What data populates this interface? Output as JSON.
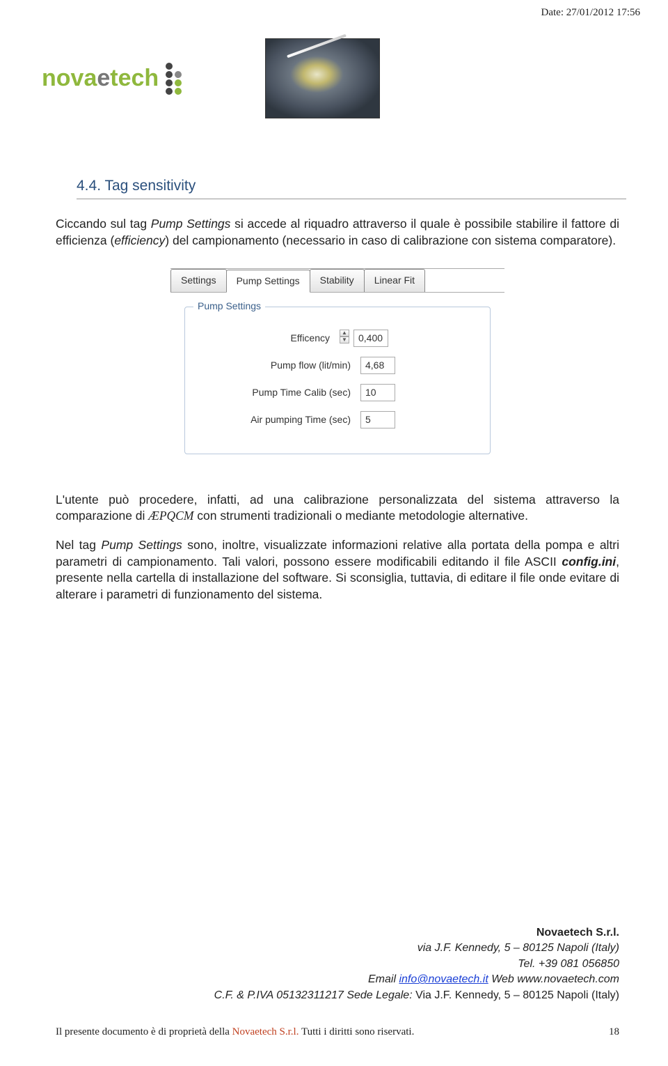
{
  "meta": {
    "date": "Date: 27/01/2012 17:56"
  },
  "logo": {
    "nova": "nova",
    "e": "e",
    "tech": "tech"
  },
  "heading": "4.4.   Tag sensitivity",
  "para1_pre": "Ciccando sul tag ",
  "para1_em": "Pump Settings",
  "para1_mid": " si accede al riquadro attraverso il quale è possibile stabilire il fattore di efficienza (",
  "para1_em2": "efficiency",
  "para1_post": ") del campionamento (necessario in caso di calibrazione con sistema comparatore).",
  "ui": {
    "tabs": [
      "Settings",
      "Pump Settings",
      "Stability",
      "Linear Fit"
    ],
    "legend": "Pump Settings",
    "rows": [
      {
        "label": "Efficency",
        "value": "0,400"
      },
      {
        "label": "Pump flow (lit/min)",
        "value": "4,68"
      },
      {
        "label": "Pump Time Calib (sec)",
        "value": "10"
      },
      {
        "label": "Air pumping Time (sec)",
        "value": "5"
      }
    ]
  },
  "para2_pre": "L'utente può procedere, infatti,  ad una calibrazione personalizzata del sistema attraverso la comparazione di ",
  "para2_app": "ÆPQCM",
  "para2_post": " con strumenti tradizionali o mediante metodologie alternative.",
  "para3_pre": "Nel tag ",
  "para3_em": "Pump Settings",
  "para3_mid": " sono, inoltre, visualizzate informazioni relative  alla portata della pompa e altri parametri di  campionamento. Tali valori,   possono essere modificabili editando il file ASCII ",
  "para3_b": "config.ini",
  "para3_post": ", presente nella cartella di installazione del software. Si sconsiglia, tuttavia, di editare il file onde evitare di alterare i parametri di funzionamento del sistema.",
  "footer": {
    "company": "Novaetech S.r.l.",
    "addr": "via J.F. Kennedy, 5 – 80125 Napoli (Italy)",
    "tel": "Tel. +39 081 056850",
    "email_lbl": "Email ",
    "email": "info@novaetech.it",
    "web_lbl": "  Web ",
    "web": "www.novaetech.com",
    "fiscal_pre": "C.F. & P.IVA 05132311217  Sede Legale: ",
    "fiscal_post": "Via J.F. Kennedy, 5 – 80125 Napoli (Italy)"
  },
  "bottom": {
    "text_pre": "Il presente documento è di proprietà della ",
    "text_company": "Novaetech S.r.l.",
    "text_post": " Tutti i diritti sono riservati.",
    "page": "18"
  }
}
